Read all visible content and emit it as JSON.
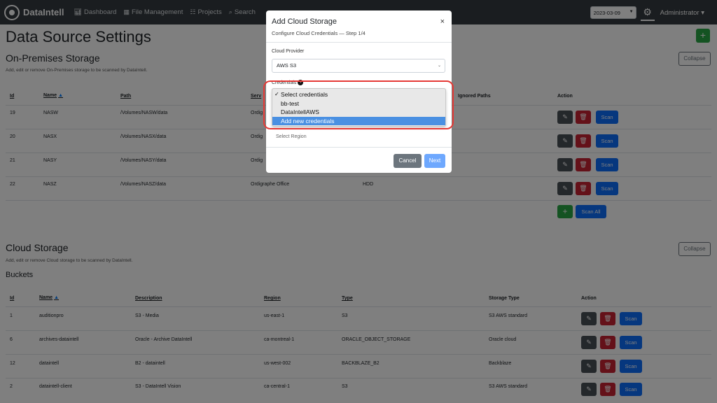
{
  "navbar": {
    "brand": "DataIntell",
    "links": [
      {
        "label": "Dashboard",
        "icon": "chart-icon"
      },
      {
        "label": "File Management",
        "icon": "table-icon"
      },
      {
        "label": "Projects",
        "icon": "sitemap-icon"
      },
      {
        "label": "Search",
        "icon": "search-icon"
      }
    ],
    "date": "2023-03-09",
    "user": "Administrator"
  },
  "page": {
    "title": "Data Source Settings",
    "add_label": "+"
  },
  "onprem": {
    "title": "On-Premises Storage",
    "subtitle": "Add, edit or remove On-Premises storage to be scanned by DataIntell.",
    "collapse_label": "Collapse",
    "headers": {
      "id": "Id",
      "name": "Name",
      "path": "Path",
      "server": "Serv",
      "ignored": "Ignored Paths",
      "action": "Action"
    },
    "rows": [
      {
        "id": "19",
        "name": "NASW",
        "path": "/Volumes/NASW/data",
        "server": "Ordig",
        "type": ""
      },
      {
        "id": "20",
        "name": "NASX",
        "path": "/Volumes/NASX/data",
        "server": "Ordig",
        "type": ""
      },
      {
        "id": "21",
        "name": "NASY",
        "path": "/Volumes/NASY/data",
        "server": "Ordig",
        "type": ""
      },
      {
        "id": "22",
        "name": "NASZ",
        "path": "/Volumes/NASZ/data",
        "server": "Ordigraphe Office",
        "type": "HDD"
      }
    ],
    "scan_label": "Scan",
    "scan_all_label": "Scan All",
    "add_label": "+"
  },
  "cloud": {
    "title": "Cloud Storage",
    "subtitle": "Add, edit or remove Cloud storage to be scanned by DataIntell.",
    "collapse_label": "Collapse",
    "buckets_title": "Buckets",
    "headers": {
      "id": "Id",
      "name": "Name",
      "description": "Description",
      "region": "Region",
      "type": "Type",
      "storage_type": "Storage Type",
      "action": "Action"
    },
    "rows": [
      {
        "id": "1",
        "name": "auditionpro",
        "description": "S3 - Media",
        "region": "us-east-1",
        "type": "S3",
        "storage_type": "S3 AWS standard"
      },
      {
        "id": "6",
        "name": "archives-dataintell",
        "description": "Oracle - Archive DataIntell",
        "region": "ca-montreal-1",
        "type": "ORACLE_OBJECT_STORAGE",
        "storage_type": "Oracle cloud"
      },
      {
        "id": "12",
        "name": "dataintell",
        "description": "B2 - dataintell",
        "region": "us-west-002",
        "type": "BACKBLAZE_B2",
        "storage_type": "Backblaze"
      },
      {
        "id": "2",
        "name": "dataintell-client",
        "description": "S3 - DataIntell Vision",
        "region": "ca-central-1",
        "type": "S3",
        "storage_type": "S3 AWS standard"
      }
    ],
    "scan_label": "Scan"
  },
  "modal": {
    "title": "Add Cloud Storage",
    "close": "×",
    "subtitle": "Configure Cloud Credentials — Step 1/4",
    "provider_label": "Cloud Provider",
    "provider_value": "AWS S3",
    "credentials_label": "Credentials",
    "region_peek": "Select Region",
    "cancel_label": "Cancel",
    "next_label": "Next"
  },
  "dropdown": {
    "options": [
      {
        "label": "Select credentials",
        "checked": true,
        "active": false
      },
      {
        "label": "bb-test",
        "checked": false,
        "active": false
      },
      {
        "label": "DataIntellAWS",
        "checked": false,
        "active": false
      },
      {
        "label": "Add new credentials",
        "checked": false,
        "active": true
      }
    ]
  },
  "colors": {
    "navbar": "#343a40",
    "primary": "#0d6efd",
    "success": "#28a745",
    "danger": "#c82333",
    "highlight": "#e53935"
  }
}
